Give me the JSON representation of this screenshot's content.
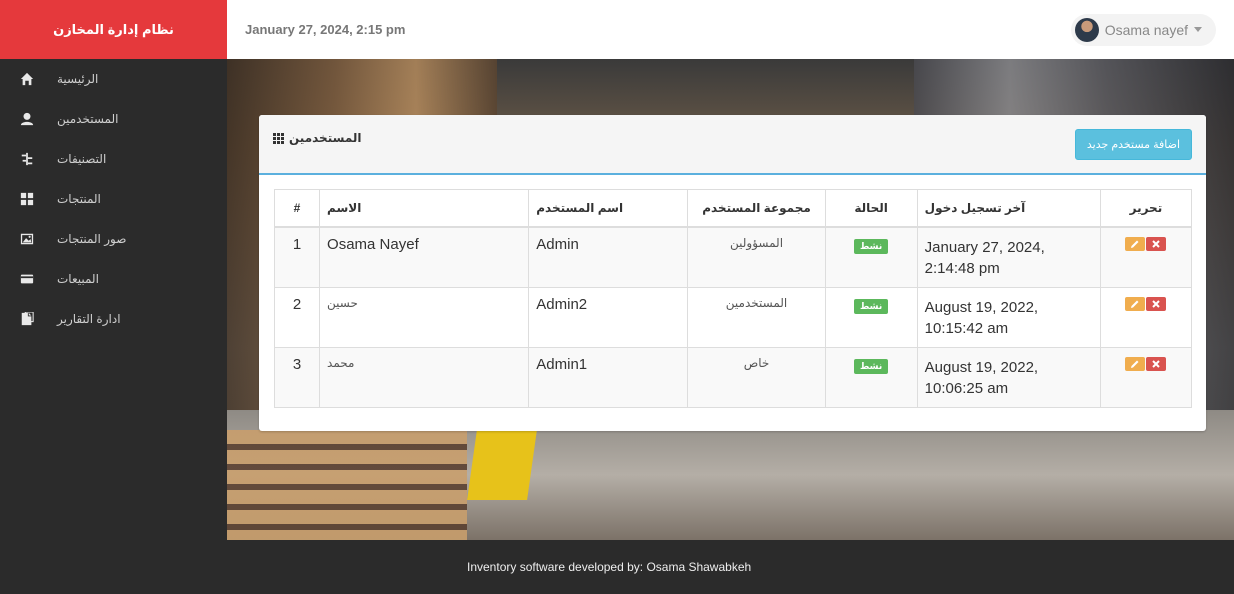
{
  "app": {
    "brand": "نظام إدارة المخازن"
  },
  "header": {
    "datetime": "January 27, 2024, 2:15 pm",
    "user_name": "Osama nayef"
  },
  "sidebar": {
    "items": [
      {
        "label": "الرئيسية",
        "icon": "home-icon"
      },
      {
        "label": "المستخدمين",
        "icon": "user-icon"
      },
      {
        "label": "التصنيفات",
        "icon": "categories-icon"
      },
      {
        "label": "المنتجات",
        "icon": "products-icon"
      },
      {
        "label": "صور المنتجات",
        "icon": "image-icon"
      },
      {
        "label": "المبيعات",
        "icon": "sales-icon"
      },
      {
        "label": "ادارة التقارير",
        "icon": "reports-icon"
      }
    ]
  },
  "panel": {
    "title": "المستخدمين",
    "add_button": "اضافة مستخدم جديد"
  },
  "table": {
    "headers": [
      "#",
      "الاسم",
      "اسم المستخدم",
      "مجموعة المستخدم",
      "الحالة",
      "آخر تسجيل دخول",
      "تحرير"
    ],
    "rows": [
      {
        "num": "1",
        "name": "Osama Nayef",
        "username": "Admin",
        "group": "المسؤولين",
        "status": "نشط",
        "last_login_1": "January 27, 2024,",
        "last_login_2": "2:14:48 pm"
      },
      {
        "num": "2",
        "name": "حسين",
        "username": "Admin2",
        "group": "المستخدمين",
        "status": "نشط",
        "last_login_1": "August 19, 2022,",
        "last_login_2": "10:15:42 am"
      },
      {
        "num": "3",
        "name": "محمد",
        "username": "Admin1",
        "group": "خاص",
        "status": "نشط",
        "last_login_1": "August 19, 2022,",
        "last_login_2": "10:06:25 am"
      }
    ]
  },
  "footer": {
    "text": "Inventory software developed by: Osama Shawabkeh"
  },
  "colors": {
    "brand": "#e5393c",
    "sidebar": "#2b2b2b",
    "info": "#5bc0de",
    "success": "#5cb85c",
    "warning": "#f0ad4e",
    "danger": "#d9534f"
  }
}
